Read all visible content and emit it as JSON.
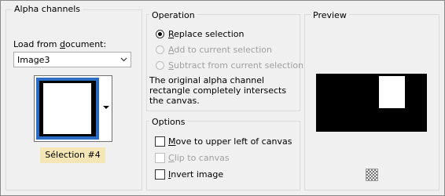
{
  "alpha_group": {
    "title": "Alpha channels",
    "load_label_pre": "Load from ",
    "load_label_u": "d",
    "load_label_post": "ocument:",
    "document_value": "Image3",
    "selection_name": "Sélection #4"
  },
  "operation_group": {
    "title": "Operation",
    "options": [
      {
        "u": "R",
        "rest": "eplace selection",
        "checked": true,
        "enabled": true
      },
      {
        "u": "A",
        "rest": "dd to current selection",
        "checked": false,
        "enabled": false
      },
      {
        "u": "S",
        "rest": "ubtract from current selection",
        "checked": false,
        "enabled": false
      }
    ],
    "description": "The original alpha channel rectangle completely intersects the canvas."
  },
  "options_group": {
    "title": "Options",
    "checks": [
      {
        "u": "M",
        "rest": "ove to upper left of canvas",
        "checked": false,
        "enabled": true
      },
      {
        "u": "C",
        "rest": "lip to canvas",
        "checked": false,
        "enabled": false
      },
      {
        "u": "I",
        "rest": "nvert image",
        "checked": false,
        "enabled": true
      }
    ]
  },
  "preview_group": {
    "title": "Preview"
  },
  "colors": {
    "badge": "#f5e6b5",
    "thumb_border": "#2b6cc4"
  }
}
